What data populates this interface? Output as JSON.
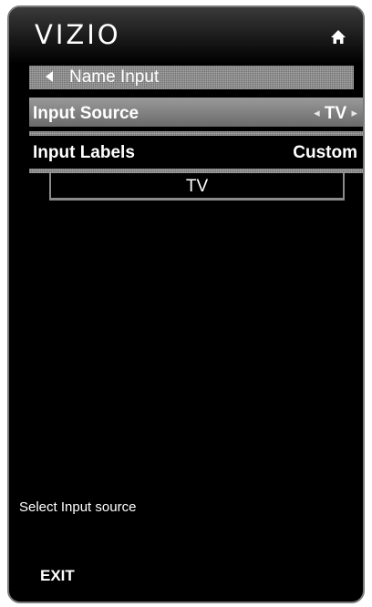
{
  "header": {
    "logo": "VIZIO",
    "home_icon": "home-icon"
  },
  "nav": {
    "back_label": "Name Input",
    "back_icon": "back-arrow-icon"
  },
  "menu": {
    "items": [
      {
        "label": "Input Source",
        "value": "TV",
        "selected": true
      },
      {
        "label": "Input Labels",
        "value": "Custom",
        "selected": false
      }
    ]
  },
  "name_field": {
    "value": "TV"
  },
  "help": {
    "text": "Select Input source"
  },
  "footer": {
    "exit_label": "EXIT"
  },
  "colors": {
    "background": "#000000",
    "highlight": "#8e8e8e",
    "text": "#ffffff"
  }
}
